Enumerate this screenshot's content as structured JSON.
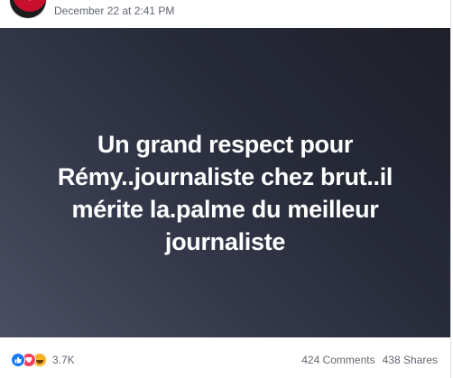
{
  "post": {
    "timestamp": "December 22 at 2:41 PM",
    "text": "Un grand respect pour Rémy..journaliste chez brut..il mérite la.palme du meilleur journaliste",
    "card_gradient": [
      "#4a4f63",
      "#1e1f29"
    ],
    "text_color": "#ffffff"
  },
  "footer": {
    "reaction_icons": [
      "like-icon",
      "love-icon",
      "haha-icon"
    ],
    "reaction_count": "3.7K",
    "comments": "424 Comments",
    "shares": "438 Shares"
  },
  "colors": {
    "like": "#1877f2",
    "love": "#f33e58",
    "haha": "#f7b125",
    "meta_text": "#616770"
  }
}
